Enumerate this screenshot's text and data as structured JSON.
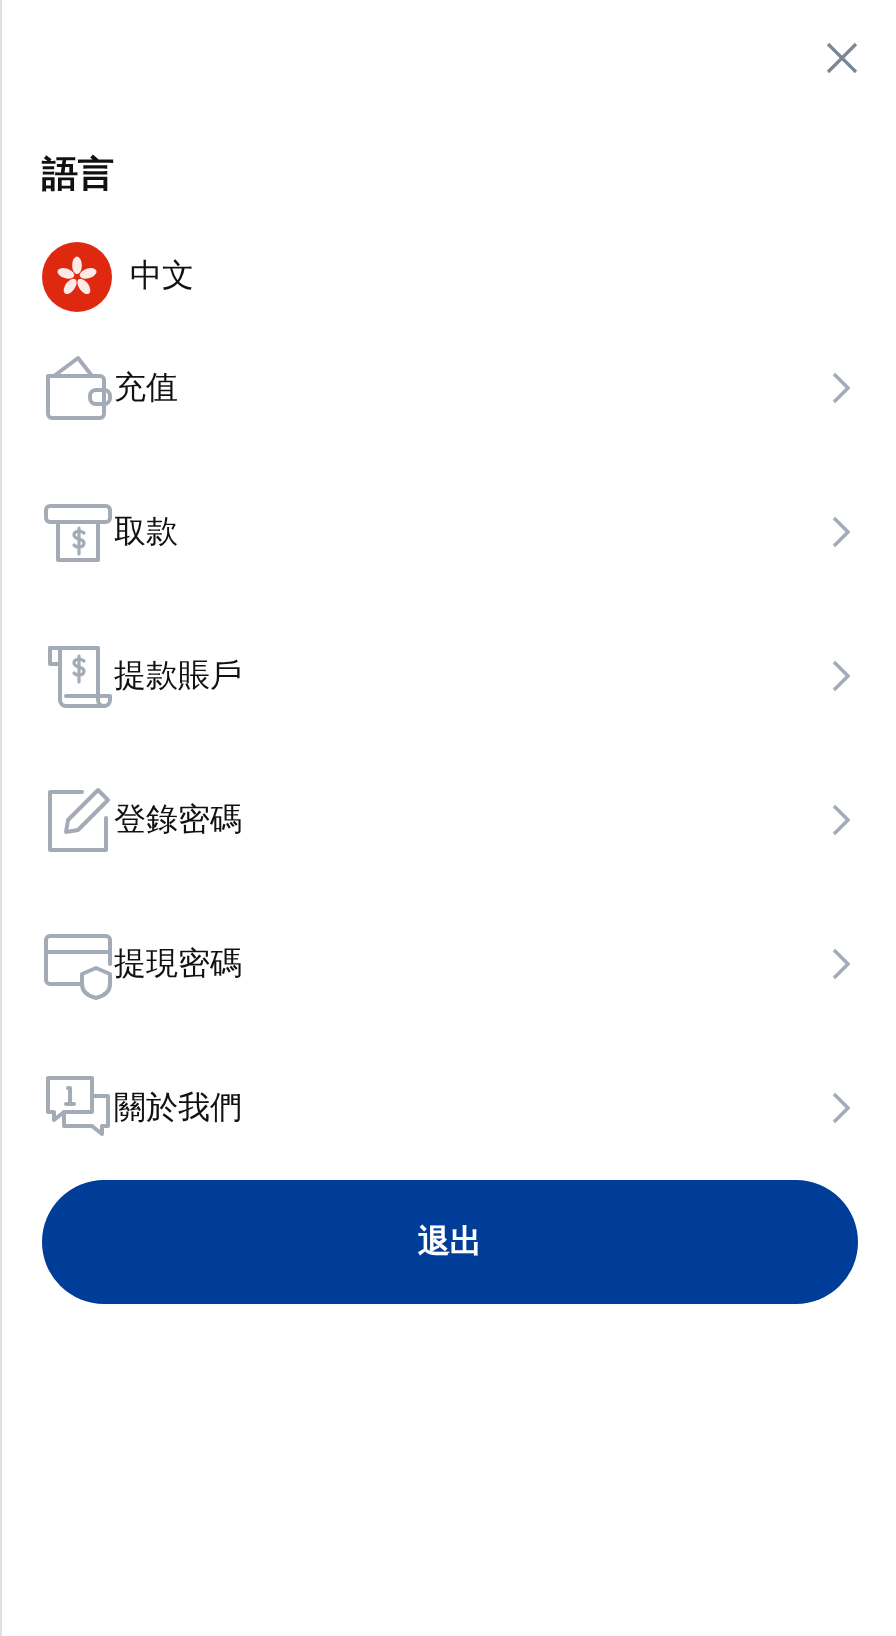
{
  "language": {
    "heading": "語言",
    "current": "中文"
  },
  "menu": [
    {
      "kind": "wallet",
      "label": "充值"
    },
    {
      "kind": "atm",
      "label": "取款"
    },
    {
      "kind": "receipt",
      "label": "提款賬戶"
    },
    {
      "kind": "edit",
      "label": "登錄密碼"
    },
    {
      "kind": "card-shield",
      "label": "提現密碼"
    },
    {
      "kind": "info-chat",
      "label": "關於我們"
    }
  ],
  "logout_button": "退出"
}
